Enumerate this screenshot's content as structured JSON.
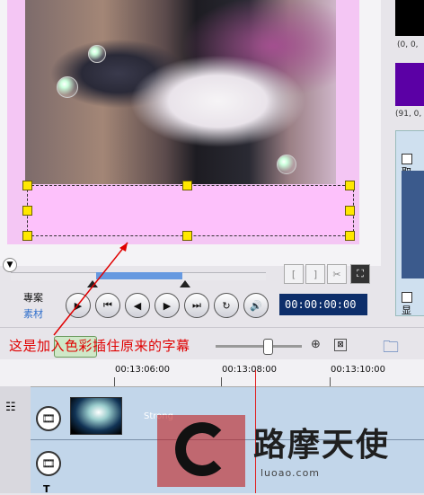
{
  "preview": {
    "swatch_black_label": "(0, 0,",
    "swatch_purple_label": "(91, 0,"
  },
  "right_panel": {
    "check1_label": "取",
    "check2_label": "显"
  },
  "player": {
    "project_label": "專案",
    "clip_label": "素材",
    "timecode": "00:00:00:00",
    "mark_in": "[",
    "mark_out": "]"
  },
  "annotation": "这是加入色彩插住原来的字幕",
  "ruler": {
    "labels": [
      "00:13:06:00",
      "00:13:08:00",
      "00:13:10:00"
    ]
  },
  "timeline": {
    "clip_name": "Strong"
  },
  "watermark": {
    "text": "路摩天使",
    "url": "luoao.com"
  },
  "colors": {
    "overlay": "#fdc1fb",
    "accent_blue": "#6699e0",
    "annotation_red": "#e00000",
    "timecode_bg": "#0d2e6a"
  }
}
